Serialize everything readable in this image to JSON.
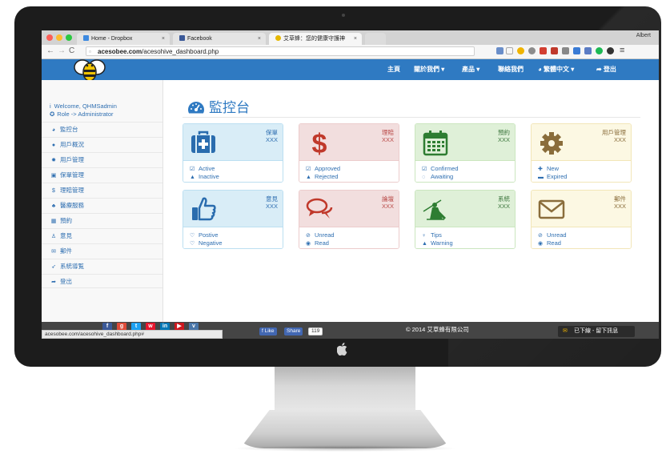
{
  "browser": {
    "profile": "Albert",
    "tabs": [
      {
        "title": "Home - Dropbox",
        "close": "×",
        "fav": "#3d8ae0"
      },
      {
        "title": "Facebook",
        "close": "×",
        "fav": "#3b5998"
      },
      {
        "title": "艾草蜂：您的健康守護神",
        "close": "×",
        "fav": "#e6b800"
      }
    ],
    "url_host": "acesobee.com",
    "url_path": "/acesohive_dashboard.php",
    "status_url": "acesobee.com/acesohive_dashboard.php#"
  },
  "navbar": {
    "items": [
      "主頁",
      "關於我們 ▾",
      "產品 ▾",
      "聯絡我們",
      "◕ 繁體中文 ▾",
      "➦ 登出"
    ],
    "color": "#2f7ac2"
  },
  "sidebar": {
    "welcome": "Welcome, QHMSadmin",
    "role": "Role -> Administrator",
    "items": [
      {
        "icon": "dashboard-icon",
        "label": "監控台"
      },
      {
        "icon": "user-icon",
        "label": "用戶概況"
      },
      {
        "icon": "gear-icon",
        "label": "用戶管理"
      },
      {
        "icon": "briefcase-icon",
        "label": "保單管理"
      },
      {
        "icon": "dollar-icon",
        "label": "理賠管理"
      },
      {
        "icon": "medical-icon",
        "label": "醫療服務"
      },
      {
        "icon": "calendar-icon",
        "label": "預約"
      },
      {
        "icon": "thumbs-up-icon",
        "label": "意見"
      },
      {
        "icon": "envelope-icon",
        "label": "郵件"
      },
      {
        "icon": "send-icon",
        "label": "系統導覧"
      },
      {
        "icon": "logout-icon",
        "label": "登出"
      }
    ]
  },
  "main": {
    "title": "監控台",
    "cards": [
      {
        "label": "保單",
        "count": "XXX",
        "theme": "blue",
        "icon": "medkit-icon",
        "links": [
          {
            "icon": "☑",
            "text": "Active"
          },
          {
            "icon": "▲",
            "text": "Inactive"
          }
        ]
      },
      {
        "label": "理賠",
        "count": "XXX",
        "theme": "red",
        "icon": "dollar-icon",
        "links": [
          {
            "icon": "☑",
            "text": "Approved"
          },
          {
            "icon": "▲",
            "text": "Rejected"
          }
        ]
      },
      {
        "label": "預約",
        "count": "XXX",
        "theme": "green",
        "icon": "calendar-icon",
        "links": [
          {
            "icon": "☑",
            "text": "Confirmed"
          },
          {
            "icon": "◌",
            "text": "Awaiting"
          }
        ]
      },
      {
        "label": "用戶管理",
        "count": "XXX",
        "theme": "yellow",
        "icon": "cog-icon",
        "links": [
          {
            "icon": "✚",
            "text": "New"
          },
          {
            "icon": "▬",
            "text": "Expired"
          }
        ]
      },
      {
        "label": "意見",
        "count": "XXX",
        "theme": "blue",
        "icon": "thumbs-up-icon",
        "links": [
          {
            "icon": "♡",
            "text": "Postive"
          },
          {
            "icon": "♡",
            "text": "Negative"
          }
        ]
      },
      {
        "label": "論壇",
        "count": "XXX",
        "theme": "red",
        "icon": "comments-icon",
        "links": [
          {
            "icon": "⊘",
            "text": "Unread"
          },
          {
            "icon": "◉",
            "text": "Read"
          }
        ]
      },
      {
        "label": "系統",
        "count": "XXX",
        "theme": "green",
        "icon": "knight-icon",
        "links": [
          {
            "icon": "♀",
            "text": "Tips"
          },
          {
            "icon": "▲",
            "text": "Warning"
          }
        ]
      },
      {
        "label": "郵件",
        "count": "XXX",
        "theme": "yellow",
        "icon": "envelope-icon",
        "links": [
          {
            "icon": "⊘",
            "text": "Unread"
          },
          {
            "icon": "◉",
            "text": "Read"
          }
        ]
      }
    ]
  },
  "footer": {
    "copyright": "© 2014 艾草蜂有限公司",
    "like": "Like",
    "share": "Share",
    "share_count": "119",
    "message": "已下線 - 留下訊息"
  }
}
